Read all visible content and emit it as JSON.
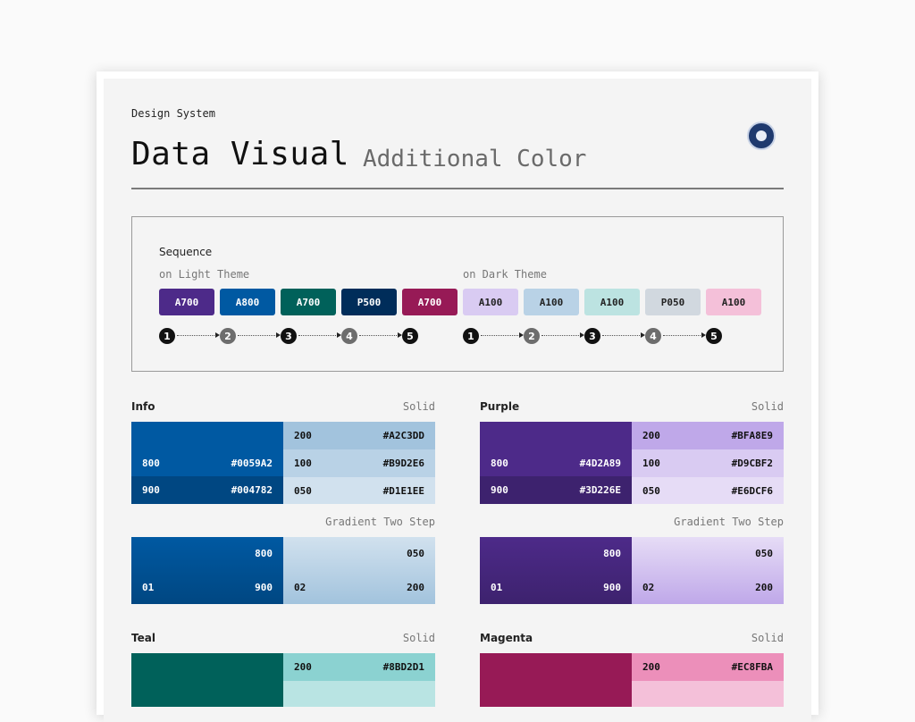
{
  "header": {
    "kicker": "Design System",
    "title": "Data Visual",
    "subtitle": "Additional Color",
    "logo": "seal-logo"
  },
  "sequence": {
    "title": "Sequence",
    "light": {
      "label": "on Light Theme",
      "chips": [
        {
          "label": "A700",
          "bg": "#4D2A89",
          "fg": "#FFFFFF"
        },
        {
          "label": "A800",
          "bg": "#0059A2",
          "fg": "#FFFFFF"
        },
        {
          "label": "A700",
          "bg": "#00615A",
          "fg": "#FFFFFF"
        },
        {
          "label": "P500",
          "bg": "#002D5A",
          "fg": "#FFFFFF"
        },
        {
          "label": "A700",
          "bg": "#971A56",
          "fg": "#FFFFFF"
        }
      ],
      "steps": [
        "1",
        "2",
        "3",
        "4",
        "5"
      ]
    },
    "dark": {
      "label": "on Dark Theme",
      "chips": [
        {
          "label": "A100",
          "bg": "#D9CBF2",
          "fg": "#222222"
        },
        {
          "label": "A100",
          "bg": "#B9D2E6",
          "fg": "#222222"
        },
        {
          "label": "A100",
          "bg": "#BCE3E1",
          "fg": "#222222"
        },
        {
          "label": "P050",
          "bg": "#D1D8DF",
          "fg": "#222222"
        },
        {
          "label": "A100",
          "bg": "#F4C0D9",
          "fg": "#222222"
        }
      ],
      "steps": [
        "1",
        "2",
        "3",
        "4",
        "5"
      ]
    }
  },
  "groups": {
    "info": {
      "name": "Info",
      "solid_label": "Solid",
      "gradient_label": "Gradient Two Step",
      "s800": {
        "label": "800",
        "hex": "#0059A2"
      },
      "s900": {
        "label": "900",
        "hex": "#004782"
      },
      "s200": {
        "label": "200",
        "hex": "#A2C3DD"
      },
      "s100": {
        "label": "100",
        "hex": "#B9D2E6"
      },
      "s050": {
        "label": "050",
        "hex": "#D1E1EE"
      },
      "g1": {
        "name": "01",
        "top": "800",
        "bottom": "900"
      },
      "g2": {
        "name": "02",
        "top": "050",
        "bottom": "200"
      }
    },
    "purple": {
      "name": "Purple",
      "solid_label": "Solid",
      "gradient_label": "Gradient Two Step",
      "s800": {
        "label": "800",
        "hex": "#4D2A89"
      },
      "s900": {
        "label": "900",
        "hex": "#3D226E"
      },
      "s200": {
        "label": "200",
        "hex": "#BFA8E9"
      },
      "s100": {
        "label": "100",
        "hex": "#D9CBF2"
      },
      "s050": {
        "label": "050",
        "hex": "#E6DCF6"
      },
      "g1": {
        "name": "01",
        "top": "800",
        "bottom": "900"
      },
      "g2": {
        "name": "02",
        "top": "050",
        "bottom": "200"
      }
    },
    "teal": {
      "name": "Teal",
      "solid_label": "Solid",
      "s800_color": "#00615A",
      "s200": {
        "label": "200",
        "hex": "#8BD2D1"
      }
    },
    "magenta": {
      "name": "Magenta",
      "solid_label": "Solid",
      "s800_color": "#971A56",
      "s200": {
        "label": "200",
        "hex": "#EC8FBA"
      }
    }
  }
}
